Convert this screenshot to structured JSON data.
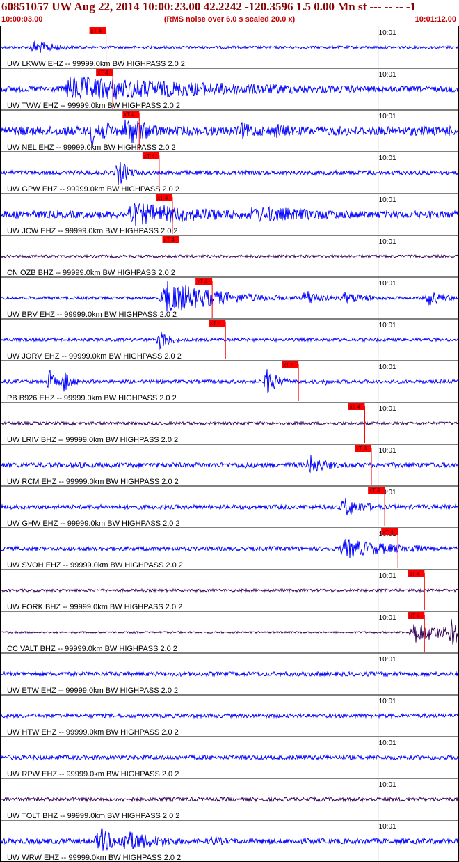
{
  "header": {
    "title": "60851057 UW Aug 22, 2014 10:00:23.00   42.2242 -120.3596  1.5 0.00 Mn st --- -- --  -1",
    "start_time": "10:00:03.00",
    "noise_note": "(RMS noise over 6.0 s scaled 20.0 x)",
    "end_time": "10:01:12.00"
  },
  "colors": {
    "title": "#8b0000",
    "subtitle": "#c00000",
    "trace_ehz": "#0000ff",
    "trace_bhz": "#33005a",
    "pick_box": "#ff0000",
    "grid": "#000000"
  },
  "chart_data": {
    "type": "line",
    "x_unit": "time",
    "x_range": [
      "10:00:03.00",
      "10:01:12.00"
    ],
    "minute_tick_label": "10:01",
    "pick_label": "xT 4",
    "series": [
      {
        "name": "UW LKWW EHZ -- 99999.0km BW  HIGHPASS  2.0  2",
        "pick_time": "10:00:19",
        "amp": 0.45,
        "noise": 0.16,
        "bursts": [
          [
            9,
            6,
            1.0
          ]
        ]
      },
      {
        "name": "UW TWW EHZ -- 99999.0km BW  HIGHPASS  2.0  2",
        "pick_time": "10:00:20",
        "amp": 0.85,
        "noise": 0.18,
        "bursts": [
          [
            18,
            55,
            0.85
          ]
        ]
      },
      {
        "name": "UW NEL EHZ -- 99999.0km BW  HIGHPASS  2.0  2",
        "pick_time": "10:00:24",
        "amp": 1.0,
        "noise": 0.25,
        "bursts": [
          [
            24,
            6,
            0.9
          ],
          [
            33,
            8,
            0.9
          ],
          [
            63,
            8,
            0.5
          ],
          [
            72,
            8,
            0.45
          ],
          [
            90,
            8,
            0.3
          ]
        ]
      },
      {
        "name": "UW GPW EHZ -- 99999.0km BW  HIGHPASS  2.0  2",
        "pick_time": "10:00:27",
        "amp": 0.8,
        "noise": 0.15,
        "bursts": [
          [
            31,
            3,
            1.0
          ]
        ]
      },
      {
        "name": "UW JCW EHZ -- 99999.0km BW  HIGHPASS  2.0  2",
        "pick_time": "10:00:29",
        "amp": 0.8,
        "noise": 0.25,
        "bursts": [
          [
            34,
            28,
            0.85
          ],
          [
            66,
            30,
            0.6
          ]
        ]
      },
      {
        "name": "CN OZB BHZ -- 99999.0km BW  HIGHPASS  2.0  2",
        "pick_time": "10:00:30",
        "amp": 0.12,
        "noise": 0.6,
        "bursts": []
      },
      {
        "name": "UW BRV EHZ -- 99999.0km BW  HIGHPASS  2.0  2",
        "pick_time": "10:00:35",
        "amp": 1.0,
        "noise": 0.08,
        "bursts": [
          [
            43,
            15,
            1.0
          ],
          [
            80,
            5,
            0.5
          ],
          [
            90,
            8,
            0.35
          ],
          [
            112,
            5,
            0.45
          ]
        ]
      },
      {
        "name": "UW JORV EHZ -- 99999.0km BW  HIGHPASS  2.0  2",
        "pick_time": "10:00:37",
        "amp": 0.6,
        "noise": 0.15,
        "bursts": [
          [
            42,
            3,
            1.0
          ]
        ]
      },
      {
        "name": "PB B926 EHZ -- 99999.0km BW  HIGHPASS  2.0  2",
        "pick_time": "10:00:48",
        "amp": 0.8,
        "noise": 0.12,
        "bursts": [
          [
            13,
            2,
            0.8
          ],
          [
            17,
            2,
            0.9
          ],
          [
            70,
            3,
            1.0
          ],
          [
            85,
            2,
            0.3
          ]
        ]
      },
      {
        "name": "UW LRIV BHZ -- 99999.0km BW  HIGHPASS  2.0  2",
        "pick_time": "10:00:58",
        "amp": 0.14,
        "noise": 0.6,
        "bursts": []
      },
      {
        "name": "UW RCM EHZ -- 99999.0km BW  HIGHPASS  2.0  2",
        "pick_time": "10:00:59",
        "amp": 0.6,
        "noise": 0.22,
        "bursts": [
          [
            81,
            5,
            1.0
          ],
          [
            64,
            2,
            0.4
          ],
          [
            20,
            4,
            0.35
          ]
        ]
      },
      {
        "name": "UW GHW EHZ -- 99999.0km BW  HIGHPASS  2.0  2",
        "pick_time": "10:01:01",
        "amp": 0.6,
        "noise": 0.2,
        "bursts": [
          [
            90,
            6,
            1.0
          ]
        ]
      },
      {
        "name": "UW SVOH EHZ -- 99999.0km BW  HIGHPASS  2.0  2",
        "pick_time": "10:01:03",
        "amp": 0.65,
        "noise": 0.18,
        "bursts": [
          [
            90,
            14,
            0.9
          ],
          [
            107,
            6,
            0.45
          ]
        ]
      },
      {
        "name": "UW FORK BHZ -- 99999.0km BW  HIGHPASS  2.0  2",
        "pick_time": "10:01:07",
        "amp": 0.12,
        "noise": 0.6,
        "bursts": []
      },
      {
        "name": "CC VALT BHZ -- 99999.0km BW  HIGHPASS  2.0  2",
        "pick_time": "10:01:07",
        "amp": 0.8,
        "noise": 0.06,
        "bursts": [
          [
            108,
            10,
            0.8
          ],
          [
            118,
            5,
            1.0
          ]
        ]
      },
      {
        "name": "UW ETW EHZ -- 99999.0km BW  HIGHPASS  2.0  2",
        "pick_time": null,
        "amp": 0.4,
        "noise": 0.3,
        "bursts": []
      },
      {
        "name": "UW HTW EHZ -- 99999.0km BW  HIGHPASS  2.0  2",
        "pick_time": null,
        "amp": 0.35,
        "noise": 0.3,
        "bursts": []
      },
      {
        "name": "UW RPW EHZ -- 99999.0km BW  HIGHPASS  2.0  2",
        "pick_time": null,
        "amp": 0.4,
        "noise": 0.3,
        "bursts": []
      },
      {
        "name": "UW TOLT BHZ -- 99999.0km BW  HIGHPASS  2.0  2",
        "pick_time": null,
        "amp": 0.2,
        "noise": 0.55,
        "bursts": []
      },
      {
        "name": "UW WRW EHZ -- 99999.0km BW  HIGHPASS  2.0  2",
        "pick_time": null,
        "amp": 0.8,
        "noise": 0.18,
        "bursts": [
          [
            26,
            5,
            1.0
          ],
          [
            32,
            12,
            0.8
          ],
          [
            55,
            8,
            0.35
          ]
        ]
      }
    ]
  }
}
